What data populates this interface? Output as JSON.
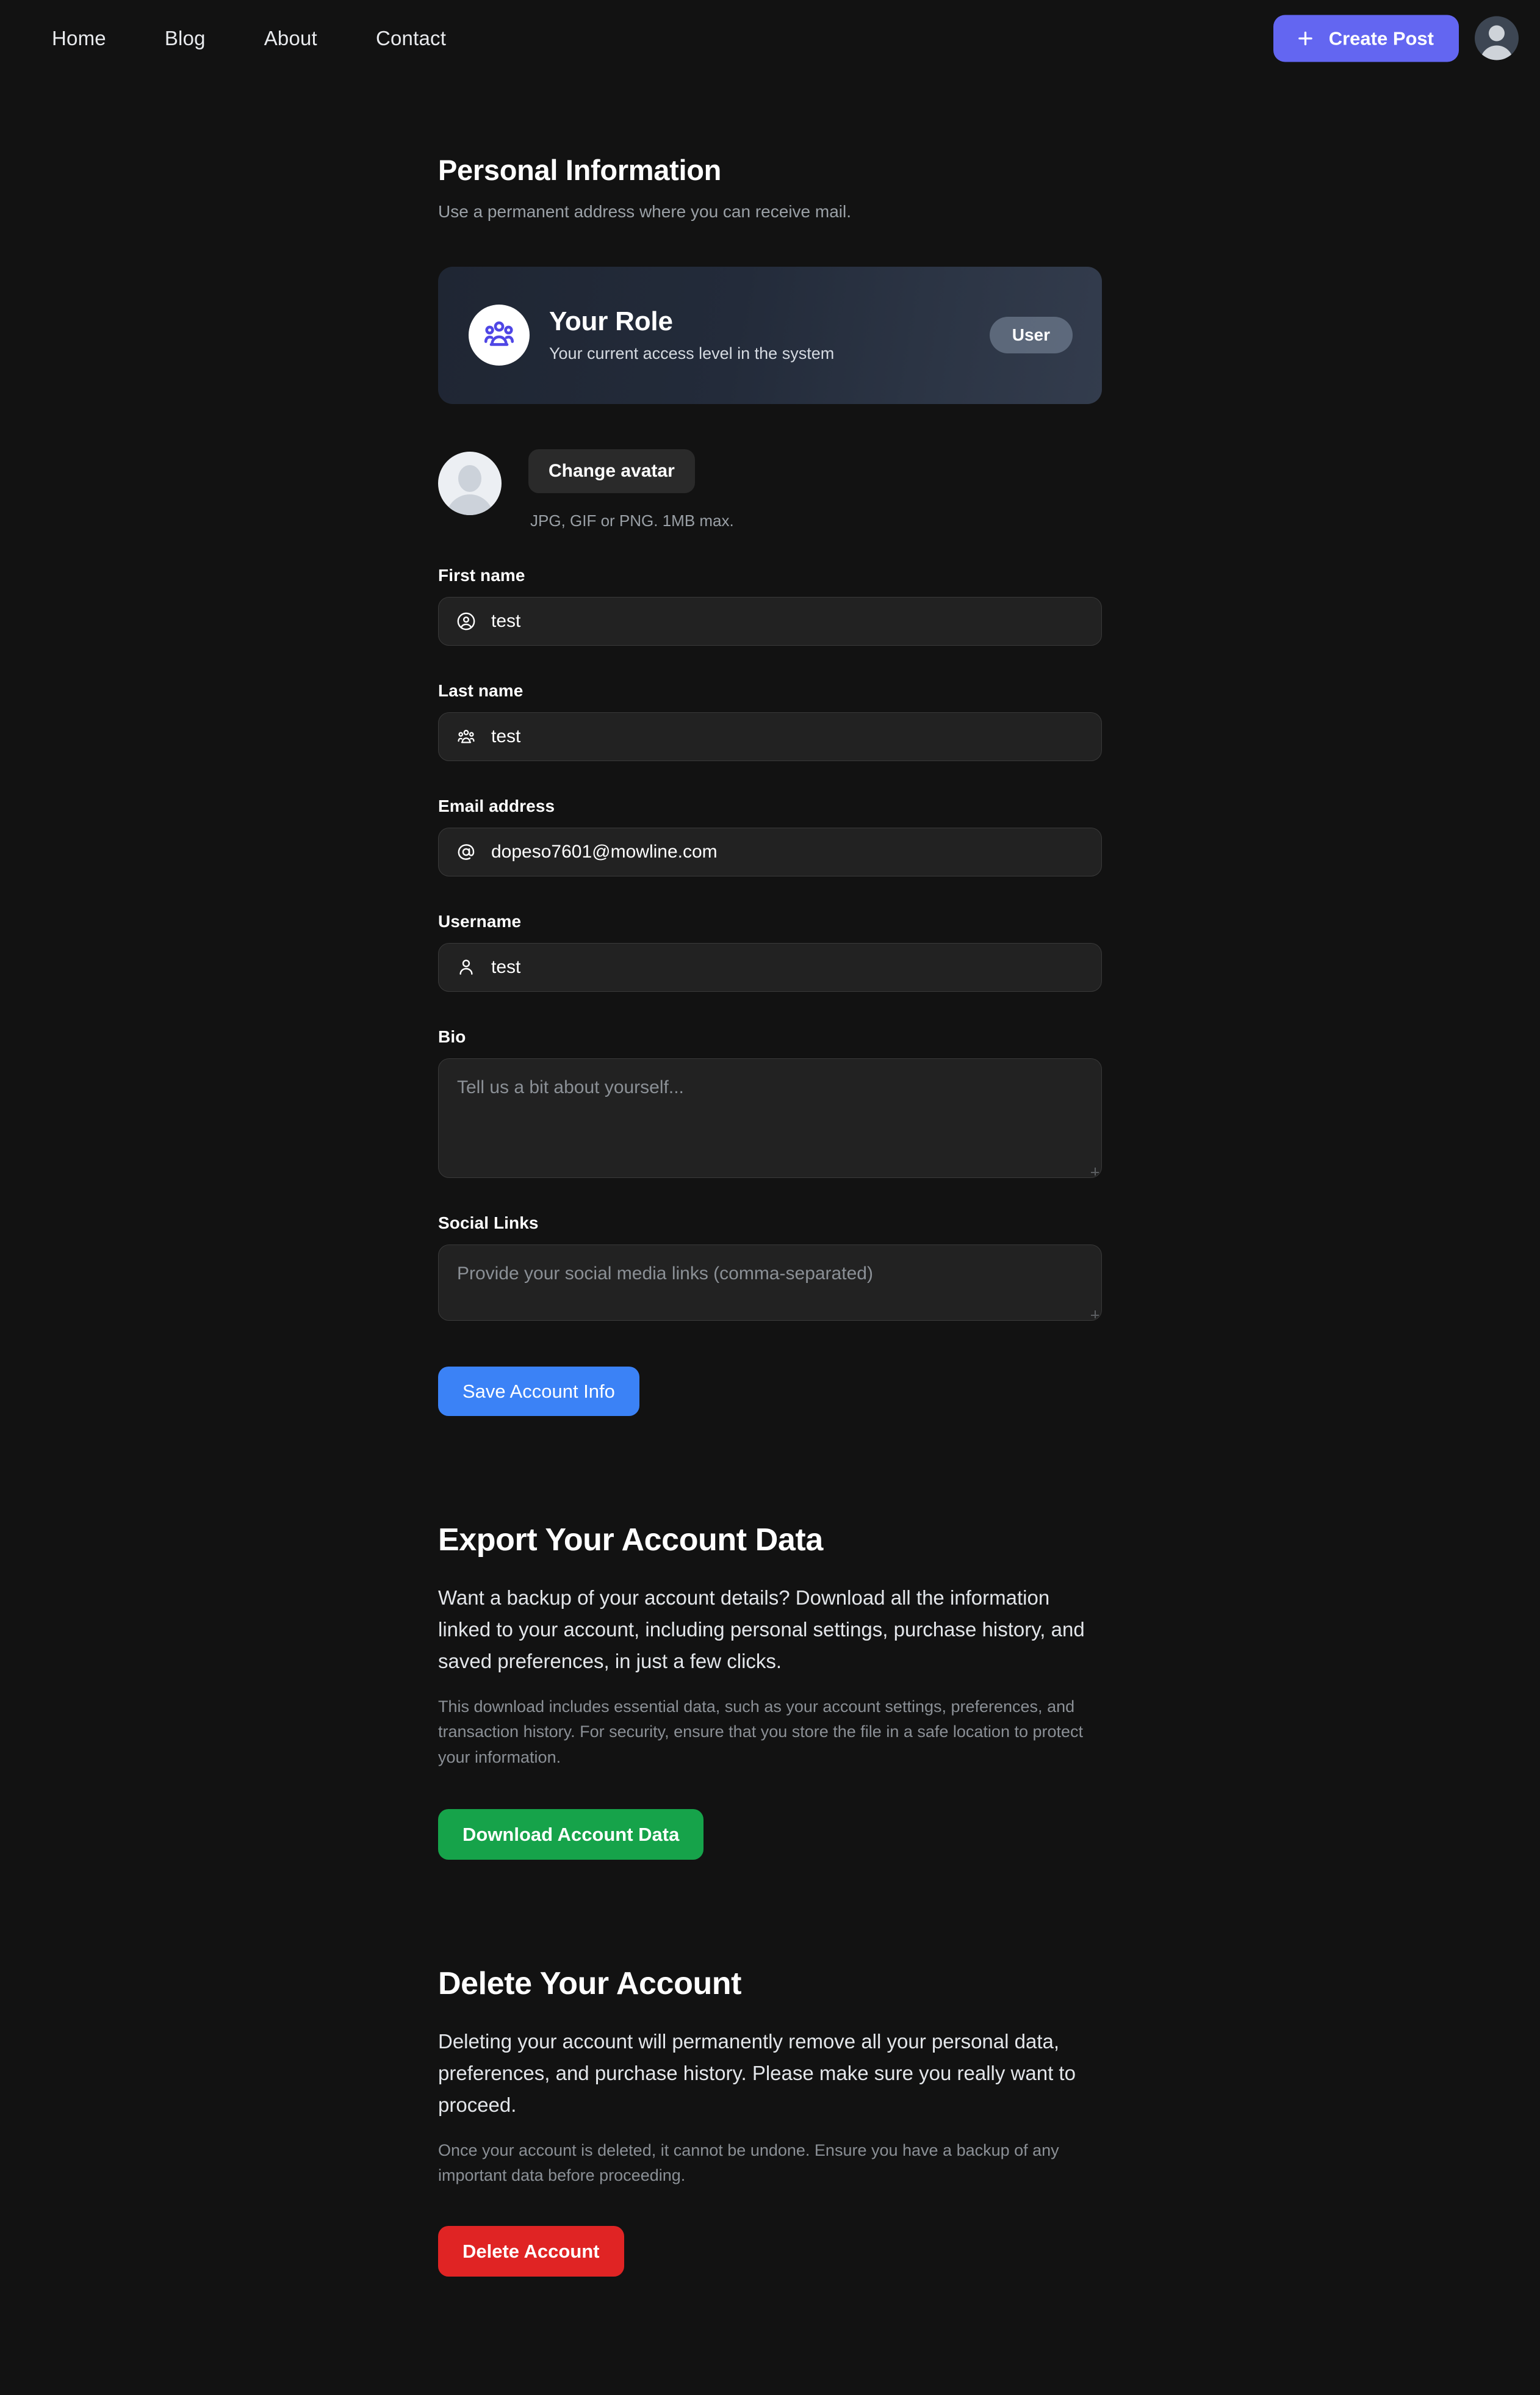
{
  "navbar": {
    "links": [
      {
        "label": "Home"
      },
      {
        "label": "Blog"
      },
      {
        "label": "About"
      },
      {
        "label": "Contact"
      }
    ],
    "create_post_label": "Create Post",
    "create_post_icon": "plus-icon",
    "avatar_icon": "user-avatar-icon",
    "accent_color": "#6366f1"
  },
  "header": {
    "title": "Personal Information",
    "subtitle": "Use a permanent address where you can receive mail."
  },
  "role_card": {
    "icon": "users-group-icon",
    "icon_color": "#4f46e5",
    "title": "Your Role",
    "subtitle": "Your current access level in the system",
    "badge": "User"
  },
  "avatar_section": {
    "avatar_icon": "user-avatar-icon",
    "change_button_label": "Change avatar",
    "hint": "JPG, GIF or PNG. 1MB max."
  },
  "form": {
    "fields": [
      {
        "label": "First name",
        "icon": "user-circle-icon",
        "value": "test",
        "placeholder": "First name"
      },
      {
        "label": "Last name",
        "icon": "users-group-icon",
        "value": "test",
        "placeholder": "Last name"
      },
      {
        "label": "Email address",
        "icon": "at-sign-icon",
        "value": "dopeso7601@mowline.com",
        "placeholder": "Email address"
      },
      {
        "label": "Username",
        "icon": "user-icon",
        "value": "test",
        "placeholder": "Username"
      }
    ],
    "bio": {
      "label": "Bio",
      "value": "",
      "placeholder": "Tell us a bit about yourself..."
    },
    "social_links": {
      "label": "Social Links",
      "value": "",
      "placeholder": "Provide your social media links (comma-separated)"
    },
    "save_label": "Save Account Info",
    "save_color": "#3b82f6"
  },
  "export_section": {
    "title": "Export Your Account Data",
    "body": "Want a backup of your account details? Download all the information linked to your account, including personal settings, purchase history, and saved preferences, in just a few clicks.",
    "note": "This download includes essential data, such as your account settings, preferences, and transaction history. For security, ensure that you store the file in a safe location to protect your information.",
    "button_label": "Download Account Data",
    "button_color": "#16a34a"
  },
  "delete_section": {
    "title": "Delete Your Account",
    "body": "Deleting your account will permanently remove all your personal data, preferences, and purchase history. Please make sure you really want to proceed.",
    "note": "Once your account is deleted, it cannot be undone. Ensure you have a backup of any important data before proceeding.",
    "button_label": "Delete Account",
    "button_color": "#e02424"
  }
}
